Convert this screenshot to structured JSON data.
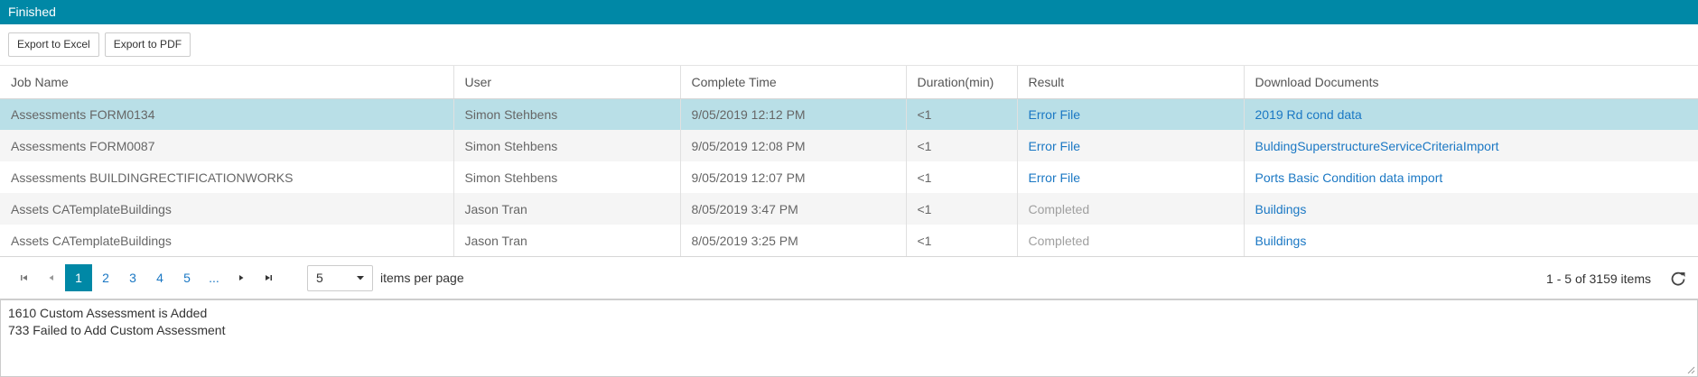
{
  "header": {
    "title": "Finished"
  },
  "toolbar": {
    "export_excel": "Export to Excel",
    "export_pdf": "Export to PDF"
  },
  "grid": {
    "columns": [
      "Job Name",
      "User",
      "Complete Time",
      "Duration(min)",
      "Result",
      "Download Documents"
    ],
    "rows": [
      {
        "job": "Assessments FORM0134",
        "user": "Simon Stehbens",
        "time": "9/05/2019 12:12 PM",
        "duration": "<1",
        "result": "Error File",
        "doc": "2019 Rd cond data"
      },
      {
        "job": "Assessments FORM0087",
        "user": "Simon Stehbens",
        "time": "9/05/2019 12:08 PM",
        "duration": "<1",
        "result": "Error File",
        "doc": "BuldingSuperstructureServiceCriteriaImport"
      },
      {
        "job": "Assessments BUILDINGRECTIFICATIONWORKS",
        "user": "Simon Stehbens",
        "time": "9/05/2019 12:07 PM",
        "duration": "<1",
        "result": "Error File",
        "doc": "Ports Basic Condition data import"
      },
      {
        "job": "Assets CATemplateBuildings",
        "user": "Jason Tran",
        "time": "8/05/2019 3:47 PM",
        "duration": "<1",
        "result": "Completed",
        "doc": "Buildings"
      },
      {
        "job": "Assets CATemplateBuildings",
        "user": "Jason Tran",
        "time": "8/05/2019 3:25 PM",
        "duration": "<1",
        "result": "Completed",
        "doc": "Buildings"
      }
    ]
  },
  "pager": {
    "pages": [
      "1",
      "2",
      "3",
      "4",
      "5",
      "..."
    ],
    "current": "1",
    "page_size": "5",
    "items_per_page_label": "items per page",
    "info": "1 - 5 of 3159 items"
  },
  "log": {
    "lines": [
      "1610 Custom Assessment is Added",
      "733 Failed to Add Custom Assessment"
    ]
  },
  "colors": {
    "accent": "#0088a6",
    "selected_row": "#b9dfe7",
    "link": "#1b78c4",
    "muted": "#a0a0a0"
  }
}
